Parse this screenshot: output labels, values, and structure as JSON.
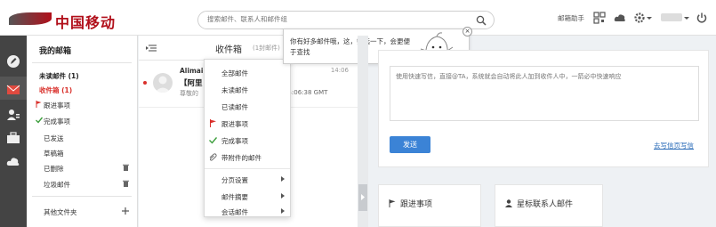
{
  "logo": {
    "text": "中国移动"
  },
  "search": {
    "placeholder": "搜索邮件、联系人和邮件组"
  },
  "header": {
    "assistant": "邮箱助手"
  },
  "folders": {
    "title": "我的邮箱",
    "items": [
      {
        "label": "未读邮件 (1)"
      },
      {
        "label": "收件箱 (1)"
      },
      {
        "label": "跟进事项"
      },
      {
        "label": "完成事项"
      },
      {
        "label": "已发送"
      },
      {
        "label": "草稿箱"
      },
      {
        "label": "已删除"
      },
      {
        "label": "垃圾邮件"
      },
      {
        "label": "其他文件夹"
      }
    ]
  },
  "list": {
    "title": "收件箱",
    "count": "(1封邮件)",
    "mail": {
      "sender": "Alimail",
      "time": "14:06",
      "subject": "【阿里",
      "preview": "尊敬的",
      "date_tail": "2-14:06:38 GMT"
    }
  },
  "dropdown": {
    "items": [
      {
        "label": "全部邮件"
      },
      {
        "label": "未读邮件"
      },
      {
        "label": "已读邮件"
      },
      {
        "label": "跟进事项"
      },
      {
        "label": "完成事项"
      },
      {
        "label": "带附件的邮件"
      },
      {
        "label": "分页设置"
      },
      {
        "label": "邮件摘要"
      },
      {
        "label": "会话邮件"
      }
    ]
  },
  "tooltip": {
    "text": "你有好多邮件哦，这，筛选一下，会更便于查找",
    "close": "×"
  },
  "reply": {
    "placeholder": "使用快速写信，直接@TA，系统就会自动将此人加到收件人中，一箭必中快速响应",
    "send": "发送",
    "full_link": "去写信页写信"
  },
  "cards": {
    "follow": "跟进事项",
    "starred": "星标联系人邮件"
  },
  "colors": {
    "brand_red": "#b10f1a",
    "accent_blue": "#3b83d6",
    "unread_red": "#d9302b",
    "check_green": "#3c9e3c"
  }
}
